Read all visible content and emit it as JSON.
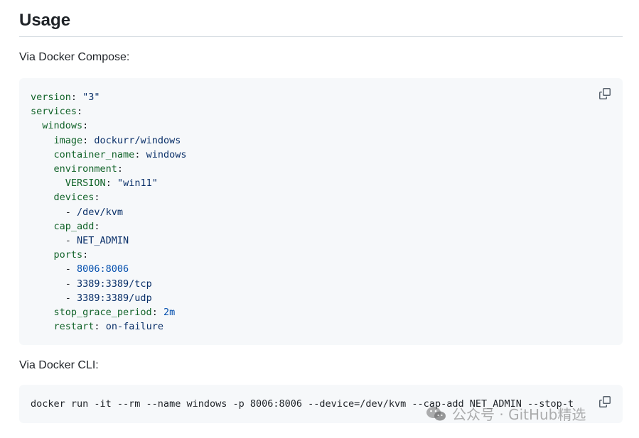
{
  "heading": "Usage",
  "compose_intro": "Via Docker Compose:",
  "cli_intro": "Via Docker CLI:",
  "compose_code": {
    "version_key": "version",
    "version_val": "\"3\"",
    "services_key": "services",
    "windows_key": "windows",
    "image_key": "image",
    "image_val": "dockurr/windows",
    "container_name_key": "container_name",
    "container_name_val": "windows",
    "environment_key": "environment",
    "version_env_key": "VERSION",
    "version_env_val": "\"win11\"",
    "devices_key": "devices",
    "device_item": "/dev/kvm",
    "cap_add_key": "cap_add",
    "cap_item": "NET_ADMIN",
    "ports_key": "ports",
    "port1": "8006:8006",
    "port2": "3389:3389/tcp",
    "port3": "3389:3389/udp",
    "stop_key": "stop_grace_period",
    "stop_val": "2m",
    "restart_key": "restart",
    "restart_val": "on-failure"
  },
  "cli_code": "docker run -it --rm --name windows -p 8006:8006 --device=/dev/kvm --cap-add NET_ADMIN --stop-t",
  "watermark_text": "公众号 · GitHub精选",
  "icons": {
    "copy": "copy-icon",
    "wechat": "wechat-logo-icon"
  }
}
